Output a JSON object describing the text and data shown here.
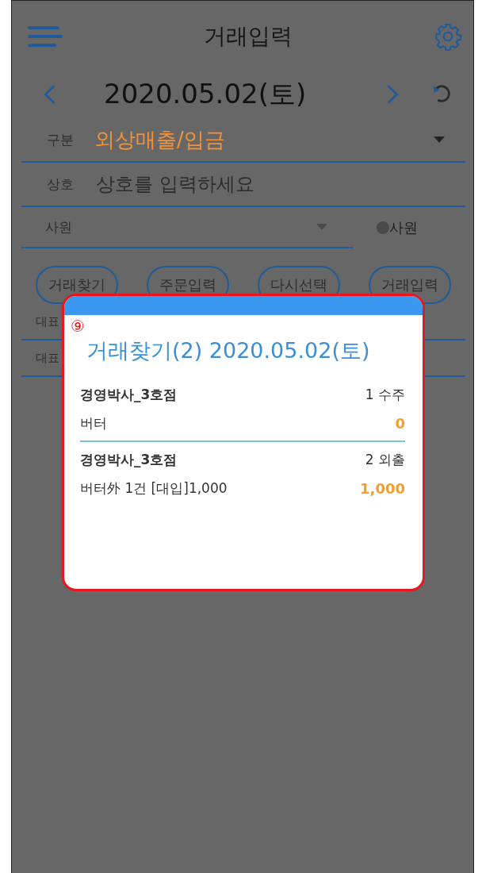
{
  "header": {
    "title": "거래입력"
  },
  "date_bar": {
    "date": "2020.05.02(토)"
  },
  "fields": [
    {
      "kind": "select",
      "label": "구분",
      "value": "외상매출/입금"
    },
    {
      "kind": "input",
      "label": "상호",
      "placeholder": "상호를 입력하세요"
    }
  ],
  "staff": {
    "placeholder": "사원",
    "radio": {
      "label": "사원",
      "checked": true
    }
  },
  "buttons": [
    "거래찾기",
    "주문입력",
    "다시선택",
    "거래입력"
  ],
  "rep_rows": [
    "대표",
    "대표"
  ],
  "dialog": {
    "marker": "⑨",
    "title": "거래찾기(2) 2020.05.02(토)",
    "entries": [
      {
        "name": "경영박사_3호점",
        "type": "1 수주",
        "detail": "버터",
        "amount": "0"
      },
      {
        "name": "경영박사_3호점",
        "type": "2 외출",
        "detail": "버터外 1건 [대입]1,000",
        "amount": "1,000"
      }
    ]
  }
}
